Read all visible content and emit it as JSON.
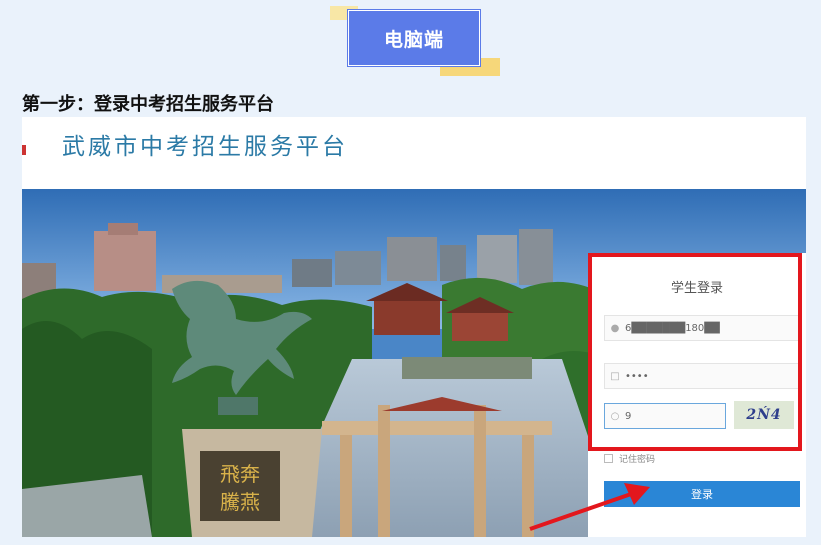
{
  "badge": {
    "label": "电脑端"
  },
  "step": {
    "title": "第一步：登录中考招生服务平台"
  },
  "screenshot": {
    "site_title": "武威市中考招生服务平台",
    "login": {
      "title": "学生登录",
      "username_value": "6███████180██",
      "password_value": "••••",
      "captcha_input_value": "9",
      "captcha_text": "2Ń4",
      "remember_label": "记住密码",
      "submit_label": "登录"
    },
    "monument_text": "飛奔騰燕"
  },
  "colors": {
    "badge": "#5b7be8",
    "highlight": "#e3171d",
    "button": "#2a86d6",
    "title": "#2b7aa6"
  }
}
